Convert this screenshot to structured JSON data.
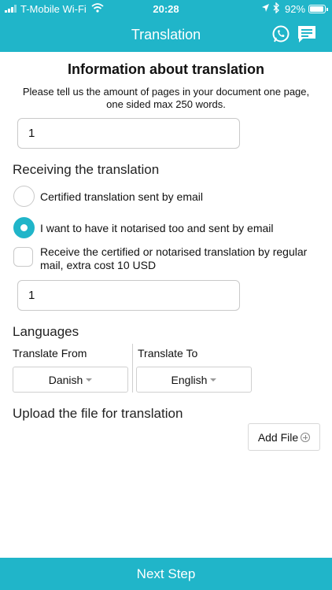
{
  "status": {
    "carrier": "T-Mobile Wi-Fi",
    "time": "20:28",
    "battery": "92%",
    "battery_level": 0.92
  },
  "nav": {
    "title": "Translation",
    "icons": [
      "phone-chat-icon",
      "message-icon"
    ]
  },
  "form": {
    "heading": "Information about translation",
    "subtitle": "Please tell us the amount of pages in your document one page, one sided max 250 words.",
    "pages_value": "1",
    "receiving_title": "Receiving the translation",
    "options": [
      {
        "label": "Certified translation sent by email",
        "selected": false
      },
      {
        "label": "I want to have it notarised too and sent by email",
        "selected": true
      }
    ],
    "mail_option": {
      "label": "Receive the certified or notarised translation by regular mail, extra cost 10 USD",
      "checked": false
    },
    "mail_quantity": "1",
    "languages_title": "Languages",
    "from_label": "Translate From",
    "from_value": "Danish",
    "to_label": "Translate To",
    "to_value": "English",
    "upload_title": "Upload the file for translation",
    "add_file_label": "Add File"
  },
  "footer": {
    "next_label": "Next Step"
  },
  "colors": {
    "accent": "#20b5c9"
  }
}
